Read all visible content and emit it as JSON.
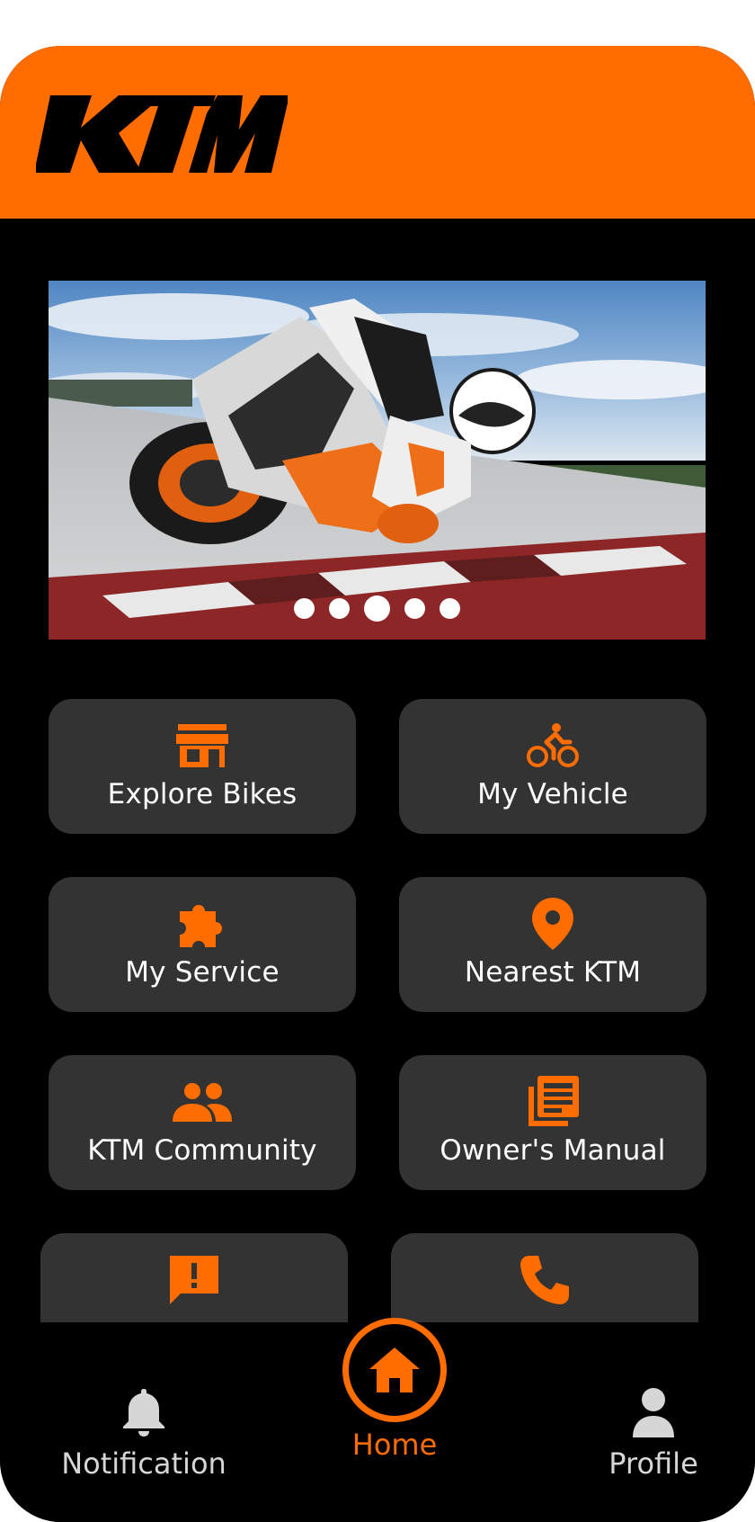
{
  "brand": {
    "logo_text": "KTM",
    "accent_color": "#ff6c00"
  },
  "carousel": {
    "slide_count": 5,
    "active_index": 2
  },
  "tiles": [
    {
      "label": "Explore Bikes",
      "icon": "store-icon"
    },
    {
      "label": "My Vehicle",
      "icon": "bike-rider-icon"
    },
    {
      "label": "My Service",
      "icon": "puzzle-icon"
    },
    {
      "label": "Nearest KTM",
      "icon": "location-pin-icon"
    },
    {
      "label": "KTM Community",
      "icon": "people-icon"
    },
    {
      "label": "Owner's Manual",
      "icon": "manual-icon"
    },
    {
      "label": "",
      "icon": "feedback-icon"
    },
    {
      "label": "",
      "icon": "phone-icon"
    }
  ],
  "bottom_nav": {
    "notification": "Notification",
    "home": "Home",
    "profile": "Profile"
  },
  "colors": {
    "tile_bg": "#333333",
    "header_bg": "#ff6c00",
    "background": "#000000",
    "inactive_nav": "#d6d6d6"
  }
}
